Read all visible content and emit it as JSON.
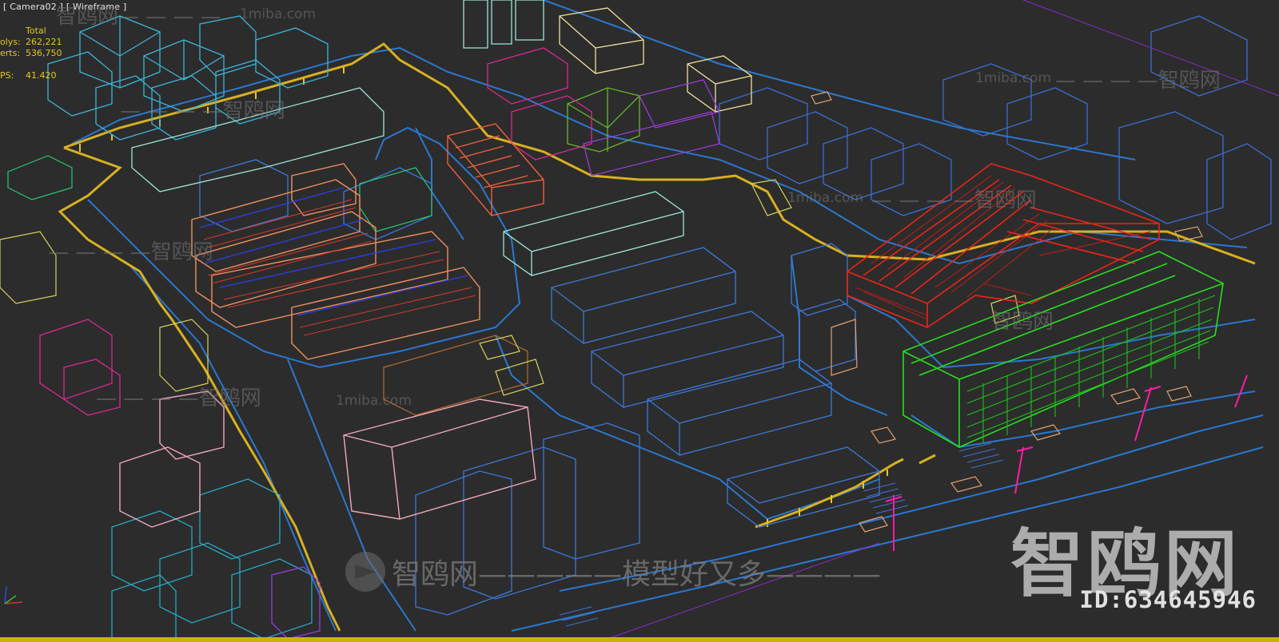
{
  "viewport": {
    "label": "[ Camera02 ] [ Wireframe ]",
    "render_mode": "Wireframe",
    "camera": "Camera02"
  },
  "stats": {
    "header": "Total",
    "rows": [
      {
        "key": "olys:",
        "value": "262,221"
      },
      {
        "key": "erts:",
        "value": "536,750"
      },
      {
        "key": "PS:",
        "value": "41.420"
      }
    ]
  },
  "watermarks": {
    "brand": "智鸥网",
    "url": "1miba.com",
    "dashes": "— — — —",
    "bottom": "智鸥网—————模型好又多————",
    "id": "ID:634645946"
  },
  "colors": {
    "background": "#2c2c2c",
    "stats_text": "#e2c81c",
    "road_outline": "#2a78d0",
    "fence": "#d8b021",
    "red_building": "#e8281e",
    "green_building": "#20c41c",
    "orange_building": "#e88c50",
    "magenta_accent": "#ff1ca8",
    "cyan_boxes": "#3cc8d8"
  },
  "icons": {
    "axis": "axis-gizmo-icon",
    "logo": "watermark-logo-icon"
  }
}
